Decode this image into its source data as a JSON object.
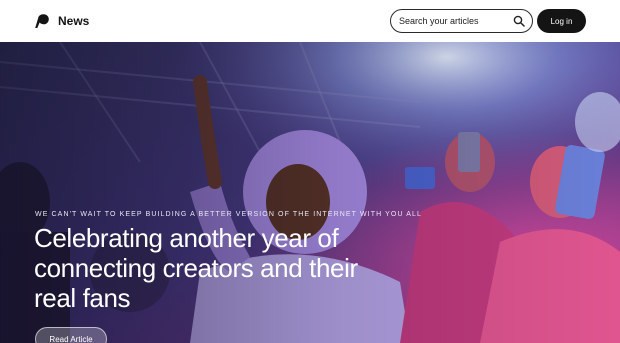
{
  "header": {
    "brand": "News",
    "search_placeholder": "Search your articles",
    "login_label": "Log in"
  },
  "hero": {
    "eyebrow": "We can't wait to keep building a better version of the internet with you all",
    "headline": "Celebrating another year of connecting creators and their real fans",
    "cta_label": "Read Article"
  },
  "colors": {
    "brand_dark": "#141414",
    "hero_purple": "#7a5fc8",
    "hero_pink": "#d8459a"
  },
  "icons": [
    "patreon-logo-icon",
    "search-icon"
  ]
}
